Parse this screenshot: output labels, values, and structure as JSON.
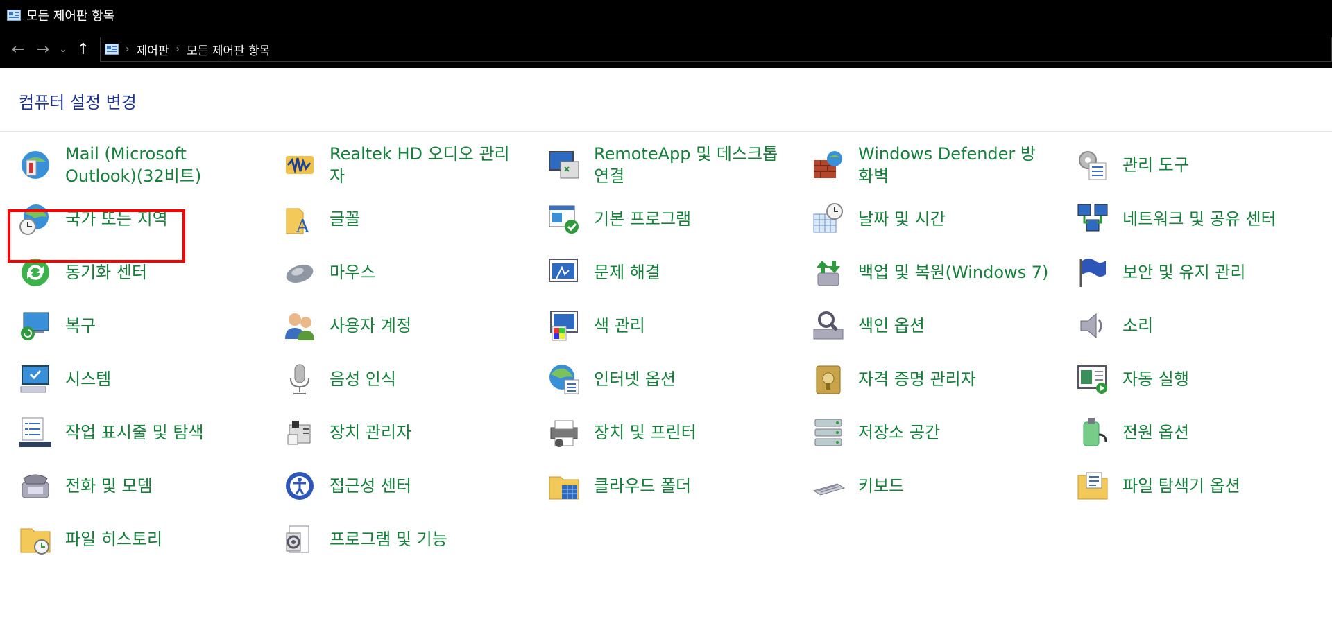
{
  "window": {
    "title": "모든 제어판 항목"
  },
  "nav": {
    "back": "←",
    "forward": "→",
    "recent": "⌄",
    "up": "↑"
  },
  "breadcrumb": {
    "items": [
      "제어판",
      "모든 제어판 항목"
    ],
    "separator": "›"
  },
  "header": {
    "heading": "컴퓨터 설정 변경"
  },
  "colors": {
    "link": "#15803b",
    "heading": "#1e3287",
    "highlight": "#ff0000"
  },
  "items": [
    {
      "label": "Mail (Microsoft Outlook)(32비트)",
      "icon": "mail-icon"
    },
    {
      "label": "Realtek HD 오디오 관리자",
      "icon": "audio-manager-icon"
    },
    {
      "label": "RemoteApp 및 데스크톱 연결",
      "icon": "remote-desktop-icon"
    },
    {
      "label": "Windows Defender 방화벽",
      "icon": "firewall-icon"
    },
    {
      "label": "관리 도구",
      "icon": "admin-tools-icon"
    },
    {
      "label": "국가 또는 지역",
      "icon": "region-icon"
    },
    {
      "label": "글꼴",
      "icon": "fonts-icon"
    },
    {
      "label": "기본 프로그램",
      "icon": "default-programs-icon"
    },
    {
      "label": "날짜 및 시간",
      "icon": "date-time-icon"
    },
    {
      "label": "네트워크 및 공유 센터",
      "icon": "network-icon"
    },
    {
      "label": "동기화 센터",
      "icon": "sync-icon"
    },
    {
      "label": "마우스",
      "icon": "mouse-icon"
    },
    {
      "label": "문제 해결",
      "icon": "troubleshoot-icon"
    },
    {
      "label": "백업 및 복원(Windows 7)",
      "icon": "backup-icon"
    },
    {
      "label": "보안 및 유지 관리",
      "icon": "security-flag-icon"
    },
    {
      "label": "복구",
      "icon": "recovery-icon"
    },
    {
      "label": "사용자 계정",
      "icon": "user-accounts-icon"
    },
    {
      "label": "색 관리",
      "icon": "color-management-icon"
    },
    {
      "label": "색인 옵션",
      "icon": "indexing-icon"
    },
    {
      "label": "소리",
      "icon": "sound-icon"
    },
    {
      "label": "시스템",
      "icon": "system-icon"
    },
    {
      "label": "음성 인식",
      "icon": "speech-icon"
    },
    {
      "label": "인터넷 옵션",
      "icon": "internet-options-icon"
    },
    {
      "label": "자격 증명 관리자",
      "icon": "credential-icon"
    },
    {
      "label": "자동 실행",
      "icon": "autoplay-icon"
    },
    {
      "label": "작업 표시줄 및 탐색",
      "icon": "taskbar-icon"
    },
    {
      "label": "장치 관리자",
      "icon": "device-manager-icon"
    },
    {
      "label": "장치 및 프린터",
      "icon": "printer-icon"
    },
    {
      "label": "저장소 공간",
      "icon": "storage-icon"
    },
    {
      "label": "전원 옵션",
      "icon": "power-icon"
    },
    {
      "label": "전화 및 모뎀",
      "icon": "phone-icon"
    },
    {
      "label": "접근성 센터",
      "icon": "accessibility-icon"
    },
    {
      "label": "클라우드 폴더",
      "icon": "cloud-folder-icon"
    },
    {
      "label": "키보드",
      "icon": "keyboard-icon"
    },
    {
      "label": "파일 탐색기 옵션",
      "icon": "folder-options-icon"
    },
    {
      "label": "파일 히스토리",
      "icon": "file-history-icon"
    },
    {
      "label": "프로그램 및 기능",
      "icon": "programs-icon"
    }
  ],
  "highlighted_item": "국가 또는 지역"
}
